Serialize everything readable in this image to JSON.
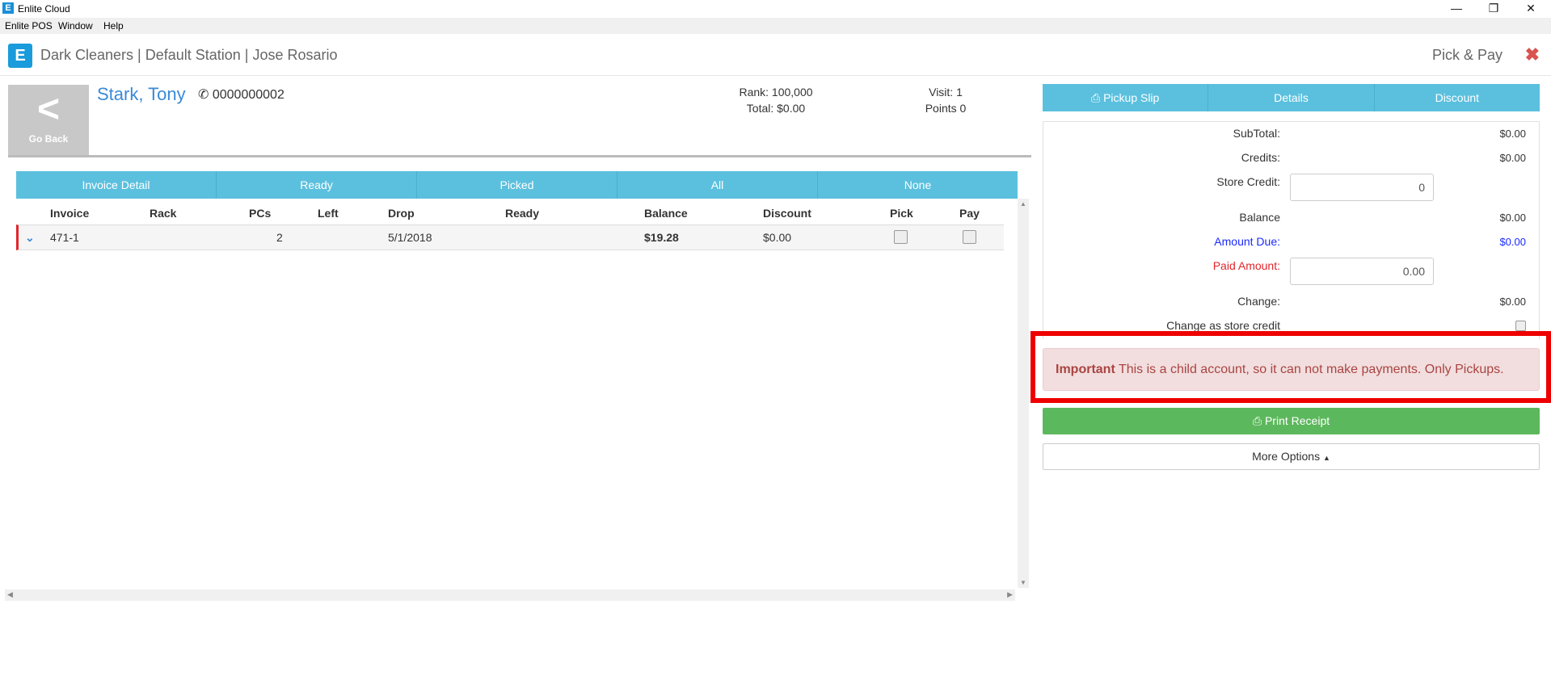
{
  "window": {
    "title": "Enlite Cloud",
    "minimize": "—",
    "restore": "❐",
    "close": "✕"
  },
  "menu": [
    "Enlite POS",
    "Window",
    "Help"
  ],
  "header": {
    "logo_letter": "E",
    "brand": "Dark Cleaners | Default Station | Jose Rosario",
    "page": "Pick & Pay",
    "close_glyph": "✖"
  },
  "customer": {
    "go_back": "Go Back",
    "name": "Stark, Tony",
    "phone": "0000000002",
    "rank": "Rank: 100,000",
    "total": "Total: $0.00",
    "visit": "Visit: 1",
    "points": "Points 0"
  },
  "filters": [
    "Invoice Detail",
    "Ready",
    "Picked",
    "All",
    "None"
  ],
  "table": {
    "columns": [
      "Invoice",
      "Rack",
      "PCs",
      "Left",
      "Drop",
      "Ready",
      "Balance",
      "Discount",
      "Pick",
      "Pay"
    ],
    "rows": [
      {
        "invoice": "471-1",
        "rack": "",
        "pcs": "2",
        "left": "",
        "drop": "5/1/2018",
        "ready": "",
        "balance": "$19.28",
        "discount": "$0.00",
        "pick": false,
        "pay": false
      }
    ]
  },
  "tabs": {
    "pickup_slip": "Pickup Slip",
    "details": "Details",
    "discount": "Discount"
  },
  "summary": {
    "subtotal_label": "SubTotal:",
    "subtotal": "$0.00",
    "credits_label": "Credits:",
    "credits": "$0.00",
    "store_credit_label": "Store Credit:",
    "store_credit": "0",
    "balance_label": "Balance",
    "balance": "$0.00",
    "amount_due_label": "Amount Due:",
    "amount_due": "$0.00",
    "paid_label": "Paid Amount:",
    "paid": "0.00",
    "change_label": "Change:",
    "change": "$0.00",
    "change_store_credit_label": "Change as store credit"
  },
  "alert": {
    "strong": "Important",
    "message": "This is a child account, so it can not make payments. Only Pickups."
  },
  "actions": {
    "print_receipt": "Print Receipt",
    "more_options": "More Options"
  },
  "colors": {
    "accent": "#5bc0de",
    "success": "#5cb85c",
    "danger": "#d9534f",
    "link": "#3a8ad6"
  }
}
